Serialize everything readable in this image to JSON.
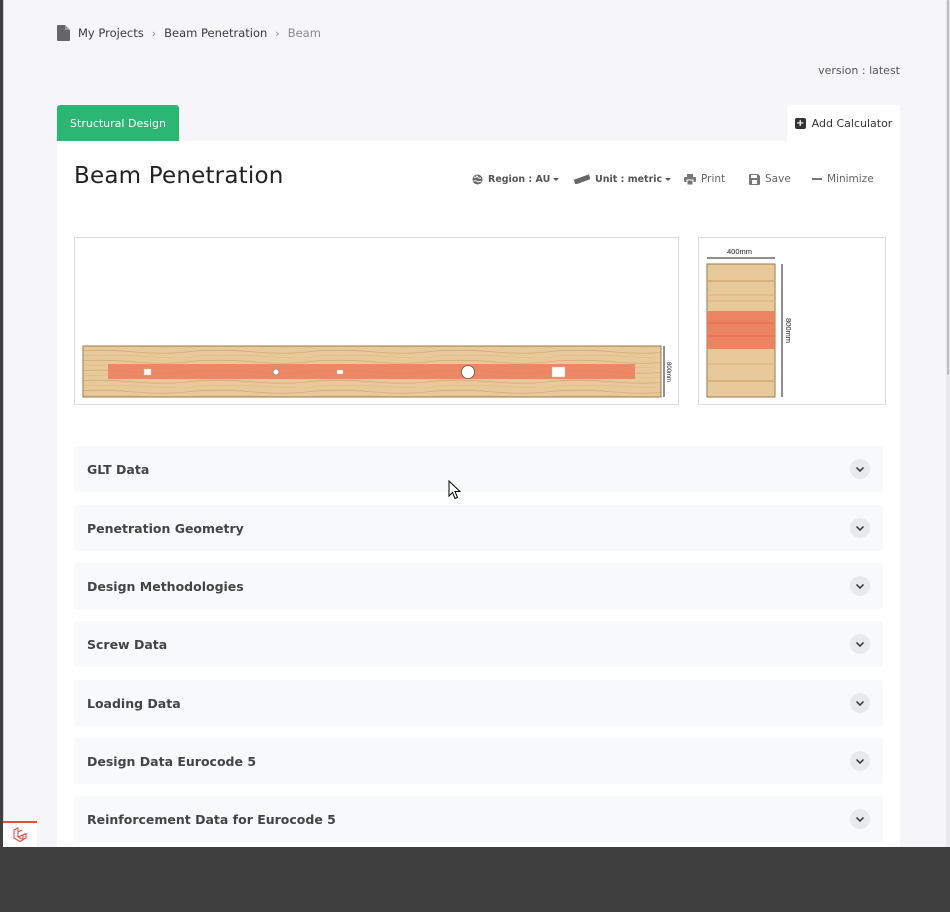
{
  "breadcrumb": {
    "items": [
      "My Projects",
      "Beam Penetration",
      "Beam"
    ]
  },
  "version": "version : latest",
  "tabs": {
    "active": "Structural Design",
    "add": "Add Calculator"
  },
  "card": {
    "title": "Beam Penetration"
  },
  "toolbar": {
    "region": "Region : AU",
    "unit": "Unit : metric",
    "print": "Print",
    "save": "Save",
    "minimize": "Minimize"
  },
  "beam_drawing": {
    "depth_label": "800mm"
  },
  "section_drawing": {
    "width_label": "400mm",
    "depth_label": "800mm"
  },
  "accordions": [
    "GLT Data",
    "Penetration Geometry",
    "Design Methodologies",
    "Screw Data",
    "Loading Data",
    "Design Data Eurocode 5",
    "Reinforcement Data for Eurocode 5"
  ],
  "colors": {
    "accent": "#2bb673",
    "timber": "#e8c99a",
    "stress": "#ec7c5c"
  }
}
